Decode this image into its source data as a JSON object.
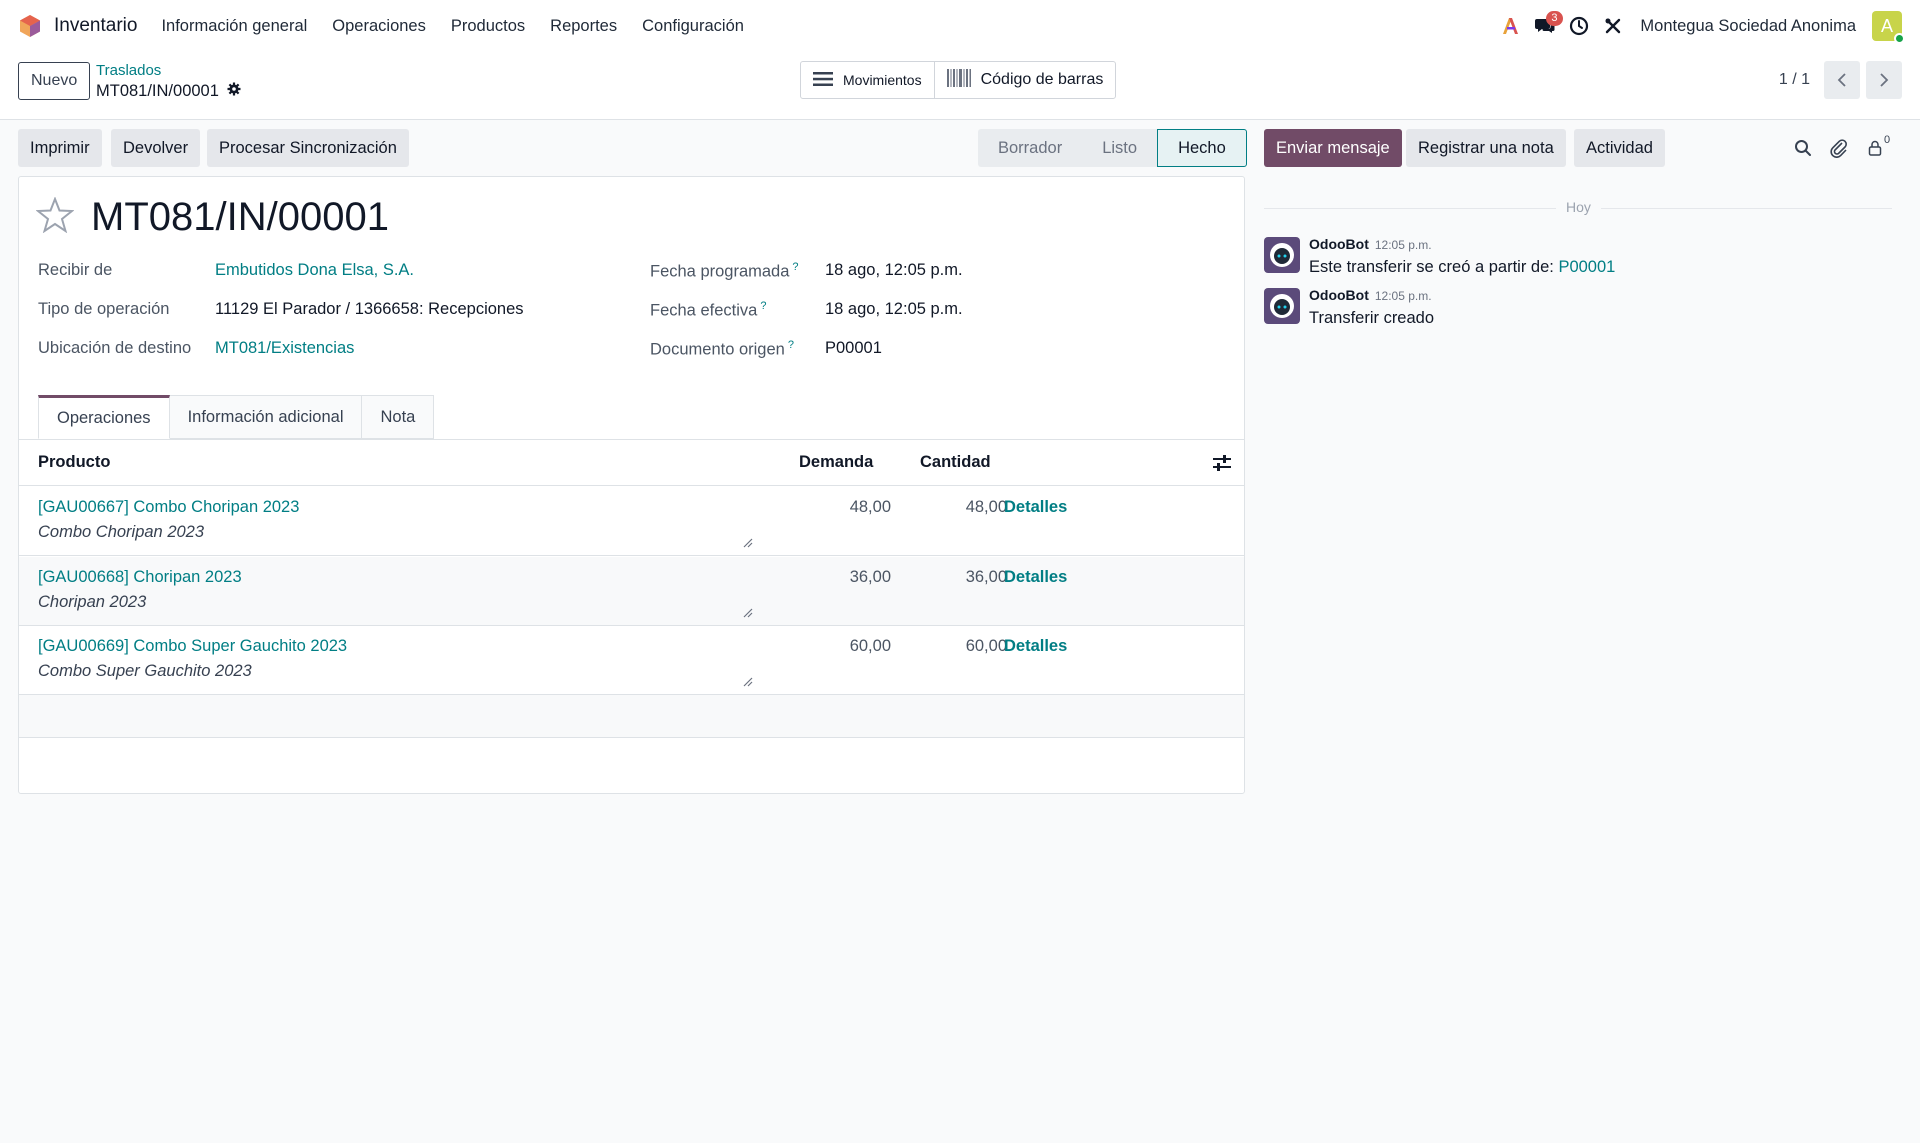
{
  "navbar": {
    "app_name": "Inventario",
    "menu": [
      "Información general",
      "Operaciones",
      "Productos",
      "Reportes",
      "Configuración"
    ],
    "messages_badge": "3",
    "company": "Montegua Sociedad Anonima",
    "avatar_letter": "A"
  },
  "control": {
    "new_label": "Nuevo",
    "breadcrumb_parent": "Traslados",
    "breadcrumb_current": "MT081/IN/00001",
    "smart_moves": "Movimientos",
    "smart_barcode": "Código de barras",
    "pager": "1 / 1"
  },
  "actions": {
    "print": "Imprimir",
    "return": "Devolver",
    "sync": "Procesar Sincronización"
  },
  "status": {
    "steps": [
      "Borrador",
      "Listo",
      "Hecho"
    ],
    "current": "Hecho"
  },
  "form": {
    "title": "MT081/IN/00001",
    "receive_from_label": "Recibir de",
    "receive_from_value": "Embutidos Dona Elsa, S.A.",
    "operation_type_label": "Tipo de operación",
    "operation_type_value": "11129 El Parador / 1366658: Recepciones",
    "dest_location_label": "Ubicación de destino",
    "dest_location_value": "MT081/Existencias",
    "scheduled_date_label": "Fecha programada",
    "scheduled_date_value": "18 ago, 12:05 p.m.",
    "effective_date_label": "Fecha efectiva",
    "effective_date_value": "18 ago, 12:05 p.m.",
    "source_doc_label": "Documento origen",
    "source_doc_value": "P00001",
    "help_mark": "?"
  },
  "tabs": [
    "Operaciones",
    "Información adicional",
    "Nota"
  ],
  "table": {
    "columns": {
      "product": "Producto",
      "demand": "Demanda",
      "quantity": "Cantidad"
    },
    "rows": [
      {
        "product": "[GAU00667] Combo Choripan 2023",
        "desc": "Combo Choripan 2023",
        "demand": "48,00",
        "quantity": "48,00",
        "details": "Detalles"
      },
      {
        "product": "[GAU00668] Choripan 2023",
        "desc": "Choripan 2023",
        "demand": "36,00",
        "quantity": "36,00",
        "details": "Detalles"
      },
      {
        "product": "[GAU00669] Combo Super Gauchito 2023",
        "desc": "Combo Super Gauchito 2023",
        "demand": "60,00",
        "quantity": "60,00",
        "details": "Detalles"
      }
    ]
  },
  "chatter": {
    "send_message": "Enviar mensaje",
    "log_note": "Registrar una nota",
    "activity": "Actividad",
    "followers_count": "0",
    "today": "Hoy",
    "messages": [
      {
        "author": "OdooBot",
        "time": "12:05 p.m.",
        "text": "Este transferir se creó a partir de: ",
        "link": "P00001"
      },
      {
        "author": "OdooBot",
        "time": "12:05 p.m.",
        "text": "Transferir creado",
        "link": ""
      }
    ]
  },
  "colors": {
    "primary": "#714b67",
    "link": "#017e84",
    "badge": "#d9534f",
    "avatar": "#c8d44a"
  }
}
